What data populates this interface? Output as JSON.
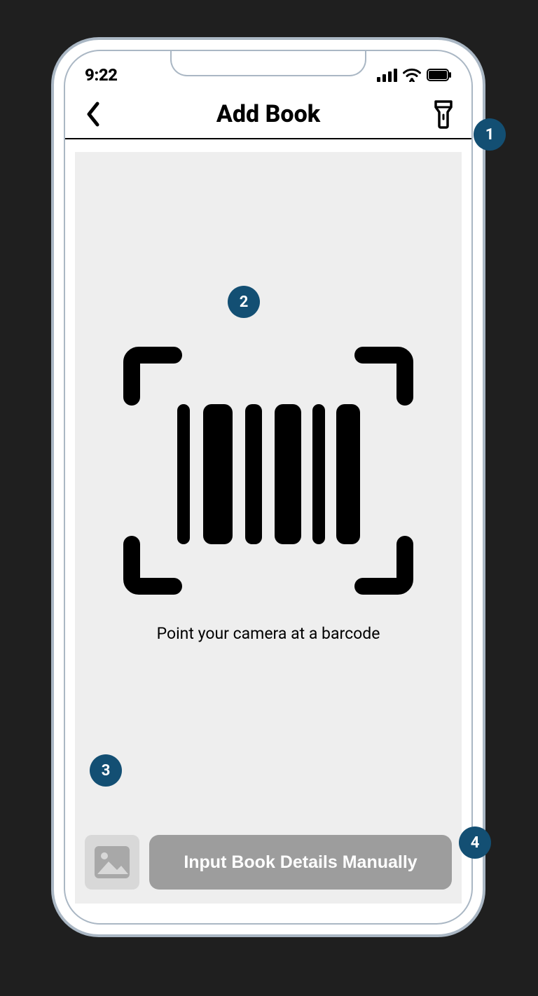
{
  "status": {
    "time": "9:22"
  },
  "nav": {
    "title": "Add Book"
  },
  "scan": {
    "hint": "Point your camera at a barcode"
  },
  "bottom": {
    "manual_label": "Input Book Details Manually"
  },
  "callouts": {
    "c1": "1",
    "c2": "2",
    "c3": "3",
    "c4": "4"
  }
}
